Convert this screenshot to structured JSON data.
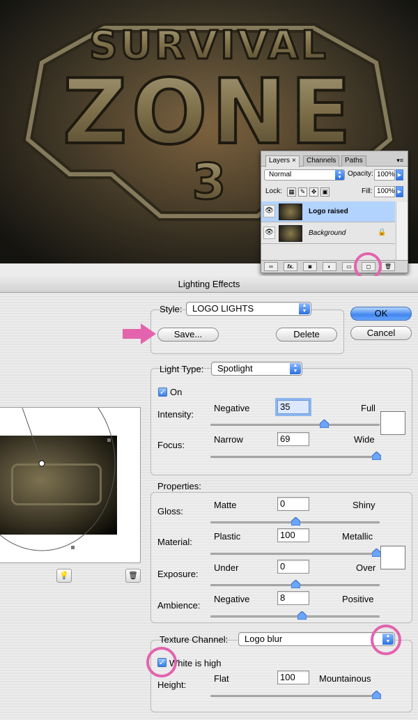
{
  "artwork": {
    "line1": "SURVIVAL",
    "line2": "ZONE",
    "line3": "3"
  },
  "layers_panel": {
    "tabs": [
      {
        "label": "Layers",
        "close": "×"
      },
      {
        "label": "Channels"
      },
      {
        "label": "Paths"
      }
    ],
    "blend_mode": "Normal",
    "opacity_label": "Opacity:",
    "opacity": "100%",
    "lock_label": "Lock:",
    "fill_label": "Fill:",
    "fill": "100%",
    "layers": [
      {
        "name": "Logo raised",
        "selected": true
      },
      {
        "name": "Background",
        "locked": true
      }
    ],
    "bottom_buttons": [
      "link-icon",
      "fx-icon",
      "mask-icon",
      "adjustment-icon",
      "folder-icon",
      "new-layer-icon",
      "trash-icon"
    ],
    "fx_label": "fx."
  },
  "dialog": {
    "title": "Lighting Effects",
    "style_label": "Style:",
    "style_value": "LOGO LIGHTS",
    "save_label": "Save...",
    "delete_label": "Delete",
    "ok_label": "OK",
    "cancel_label": "Cancel",
    "light_type_label": "Light Type:",
    "light_type_value": "Spotlight",
    "on_label": "On",
    "intensity": {
      "label": "Intensity:",
      "min": "Negative",
      "max": "Full",
      "value": "35",
      "fraction": 0.68
    },
    "focus": {
      "label": "Focus:",
      "min": "Narrow",
      "max": "Wide",
      "value": "69",
      "fraction": 1.0
    },
    "properties_label": "Properties:",
    "gloss": {
      "label": "Gloss:",
      "min": "Matte",
      "max": "Shiny",
      "value": "0",
      "fraction": 0.5
    },
    "material": {
      "label": "Material:",
      "min": "Plastic",
      "max": "Metallic",
      "value": "100",
      "fraction": 1.0
    },
    "exposure": {
      "label": "Exposure:",
      "min": "Under",
      "max": "Over",
      "value": "0",
      "fraction": 0.5
    },
    "ambience": {
      "label": "Ambience:",
      "min": "Negative",
      "max": "Positive",
      "value": "8",
      "fraction": 0.54
    },
    "texture_channel_label": "Texture Channel:",
    "texture_channel_value": "Logo blur",
    "white_is_high_label": "White is high",
    "height": {
      "label": "Height:",
      "min": "Flat",
      "max": "Mountainous",
      "value": "100",
      "fraction": 1.0
    }
  },
  "colors": {
    "annotation": "#e363ae",
    "accent": "#3a7fe6",
    "selected_layer": "#b3d3ff"
  }
}
